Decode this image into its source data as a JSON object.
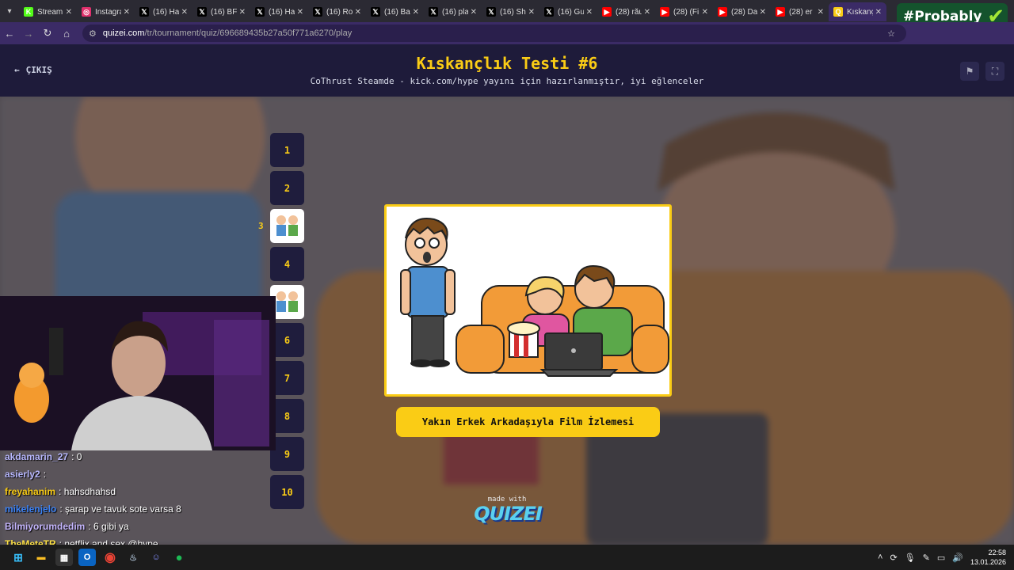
{
  "browser": {
    "tabs": [
      {
        "title": "Stream",
        "icon": "kick-icon",
        "color": "#53fc18",
        "glyph": "K"
      },
      {
        "title": "Instagram",
        "icon": "instagram-icon",
        "color": "#e1306c",
        "glyph": "◎"
      },
      {
        "title": "(16) Ha",
        "icon": "x-icon",
        "color": "#000000",
        "glyph": "𝕏"
      },
      {
        "title": "(16) BF",
        "icon": "x-icon",
        "color": "#000000",
        "glyph": "𝕏"
      },
      {
        "title": "(16) Ha",
        "icon": "x-icon",
        "color": "#000000",
        "glyph": "𝕏"
      },
      {
        "title": "(16) Ro",
        "icon": "x-icon",
        "color": "#000000",
        "glyph": "𝕏"
      },
      {
        "title": "(16) Ba",
        "icon": "x-icon",
        "color": "#000000",
        "glyph": "𝕏"
      },
      {
        "title": "(16) pla",
        "icon": "x-icon",
        "color": "#000000",
        "glyph": "𝕏"
      },
      {
        "title": "(16) Sh",
        "icon": "x-icon",
        "color": "#000000",
        "glyph": "𝕏"
      },
      {
        "title": "(16) Gu",
        "icon": "x-icon",
        "color": "#000000",
        "glyph": "𝕏"
      },
      {
        "title": "(28) rău",
        "icon": "youtube-icon",
        "color": "#ff0000",
        "glyph": "▶"
      },
      {
        "title": "(28) (Fi",
        "icon": "youtube-icon",
        "color": "#ff0000",
        "glyph": "▶"
      },
      {
        "title": "(28) Da",
        "icon": "youtube-icon",
        "color": "#ff0000",
        "glyph": "▶"
      },
      {
        "title": "(28) er",
        "icon": "youtube-icon",
        "color": "#ff0000",
        "glyph": "▶"
      },
      {
        "title": "Kıskanç",
        "icon": "quizei-icon",
        "color": "#facc15",
        "glyph": "Q",
        "active": true
      }
    ],
    "overlay_badge": "#Probably",
    "url_host": "quizei.com",
    "url_path": "/tr/tournament/quiz/696689435b27a50f771a6270/play"
  },
  "header": {
    "exit_label": "ÇIKIŞ",
    "title": "Kıskançlık Testi #6",
    "subtitle": "CoThrust Steamde - kick.com/hype yayını için hazırlanmıştır, iyi eğlenceler"
  },
  "rounds": [
    {
      "label": "1"
    },
    {
      "label": "2"
    },
    {
      "label": "",
      "thumb": true,
      "marker": "3"
    },
    {
      "label": "4"
    },
    {
      "label": "",
      "thumb": true
    },
    {
      "label": "6"
    },
    {
      "label": "7"
    },
    {
      "label": "8"
    },
    {
      "label": "9"
    },
    {
      "label": "10"
    }
  ],
  "question": {
    "answer_label": "Yakın Erkek Arkadaşıyla Film İzlemesi"
  },
  "footer": {
    "made_with": "made with",
    "brand": "QUIZEI"
  },
  "chat": [
    {
      "user": "akdamarin_27",
      "msg": ": 0",
      "color": "#b8b8ff"
    },
    {
      "user": "asierly2",
      "msg": ":",
      "color": "#b8b8ff"
    },
    {
      "user": "freyahanim",
      "msg": ": hahsdhahsd",
      "color": "#facc15"
    },
    {
      "user": "mikelenjelo",
      "msg": ": şarap ve tavuk sote varsa 8",
      "color": "#3b82f6"
    },
    {
      "user": "Bilmiyorumdedim",
      "msg": ": 6 gibi ya",
      "color": "#c4b5fd"
    },
    {
      "user": "TheMeteTR",
      "msg": ": netflix and sex @hype",
      "color": "#fde047"
    }
  ],
  "taskbar": {
    "time": "22:58",
    "date": "13.01.2026"
  }
}
